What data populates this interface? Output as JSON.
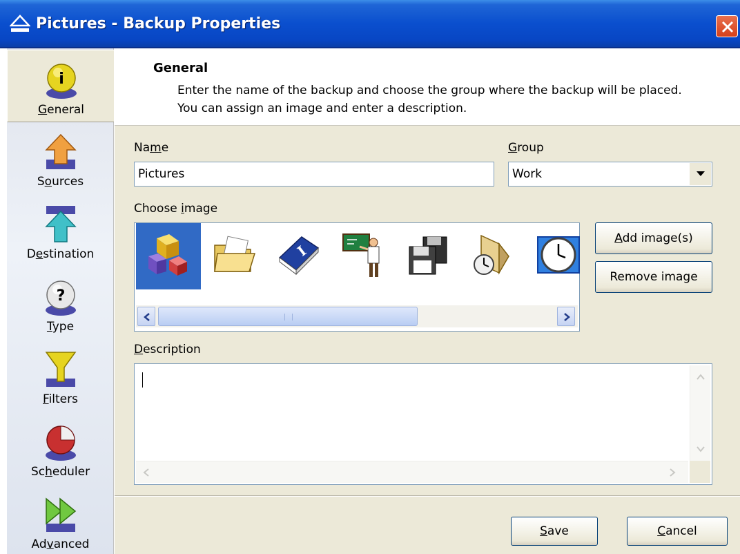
{
  "window": {
    "title": "Pictures - Backup Properties"
  },
  "sidebar": {
    "items": [
      {
        "label_html": "<u>G</u>eneral",
        "label": "General"
      },
      {
        "label_html": "S<u>o</u>urces",
        "label": "Sources"
      },
      {
        "label_html": "D<u>e</u>stination",
        "label": "Destination"
      },
      {
        "label_html": "<u>T</u>ype",
        "label": "Type"
      },
      {
        "label_html": "<u>F</u>ilters",
        "label": "Filters"
      },
      {
        "label_html": "Sc<u>h</u>eduler",
        "label": "Scheduler"
      },
      {
        "label_html": "Ad<u>v</u>anced",
        "label": "Advanced"
      }
    ]
  },
  "header": {
    "title": "General",
    "description": "Enter the name of the backup and choose the group where the backup will be placed. You can assign an image and enter a description."
  },
  "form": {
    "name_label": "Name",
    "name_value": "Pictures",
    "group_label": "Group",
    "group_value": "Work",
    "choose_image_label": "Choose image",
    "description_label": "Description",
    "description_value": ""
  },
  "buttons": {
    "add_images": "Add image(s)",
    "remove_image": "Remove image",
    "save": "Save",
    "cancel": "Cancel"
  },
  "colors": {
    "titlebar": "#0a4fce",
    "selection": "#316ac5",
    "dialog_bg": "#ece9d8"
  }
}
